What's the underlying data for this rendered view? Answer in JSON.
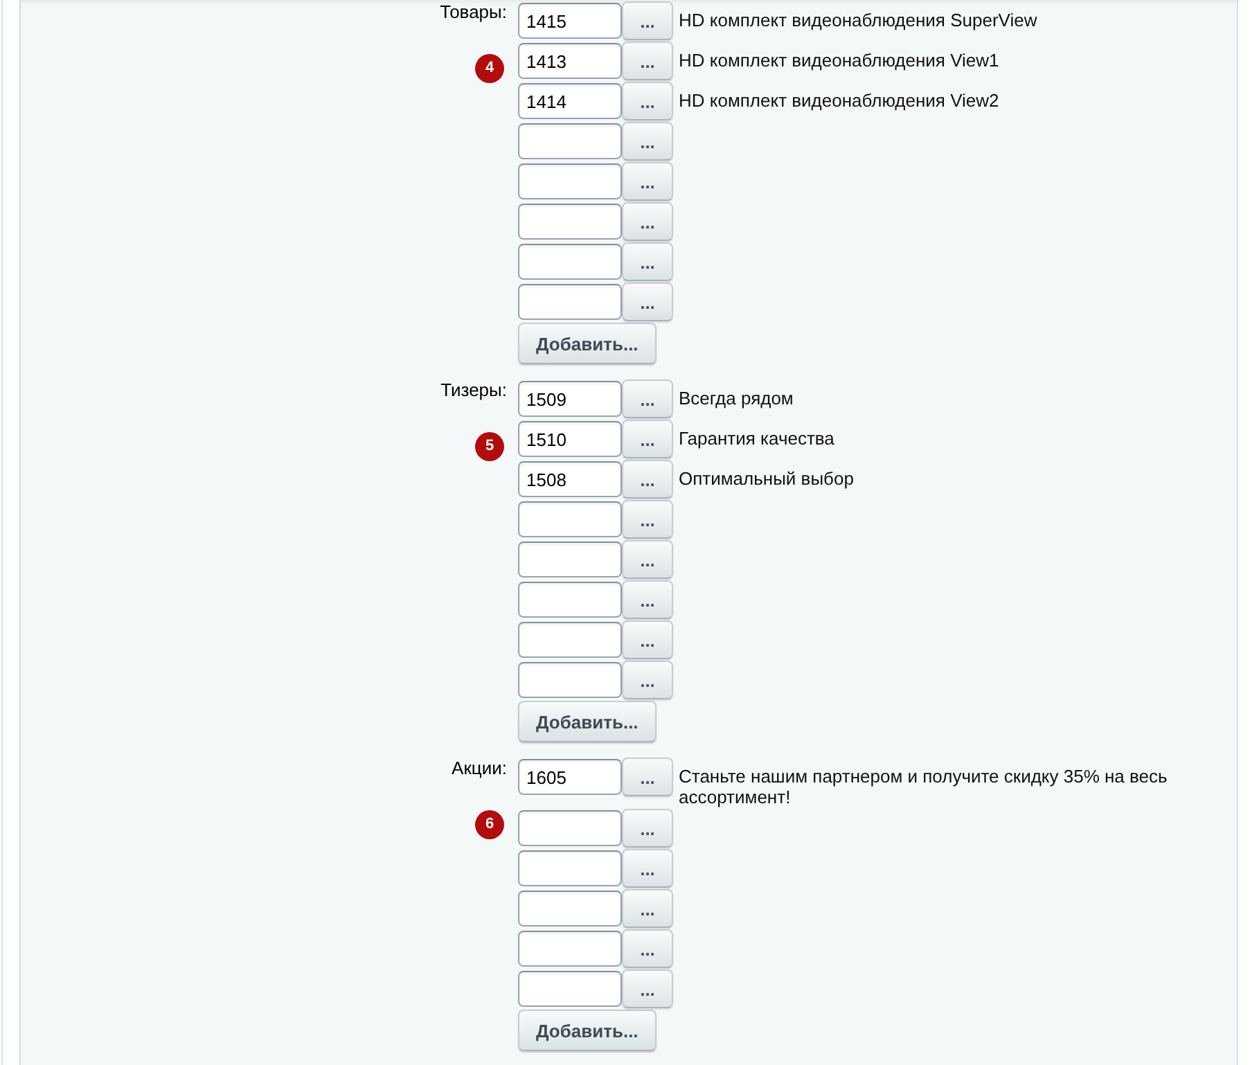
{
  "sections": [
    {
      "label": "Товары:",
      "marker": "4",
      "rows": [
        {
          "value": "1415",
          "button": "...",
          "description": "HD комплект видеонаблюдения SuperView"
        },
        {
          "value": "1413",
          "button": "...",
          "description": "HD комплект видеонаблюдения View1"
        },
        {
          "value": "1414",
          "button": "...",
          "description": "HD комплект видеонаблюдения View2"
        },
        {
          "button": "..."
        },
        {
          "button": "..."
        },
        {
          "button": "..."
        },
        {
          "button": "..."
        },
        {
          "button": "..."
        }
      ],
      "add_button": "Добавить..."
    },
    {
      "label": "Тизеры:",
      "marker": "5",
      "rows": [
        {
          "value": "1509",
          "button": "...",
          "description": "Всегда рядом"
        },
        {
          "value": "1510",
          "button": "...",
          "description": "Гарантия качества"
        },
        {
          "value": "1508",
          "button": "...",
          "description": "Оптимальный выбор"
        },
        {
          "button": "..."
        },
        {
          "button": "..."
        },
        {
          "button": "..."
        },
        {
          "button": "..."
        },
        {
          "button": "..."
        }
      ],
      "add_button": "Добавить..."
    },
    {
      "label": "Акции:",
      "marker": "6",
      "rows": [
        {
          "value": "1605",
          "button": "...",
          "description": "Станьте нашим партнером и получите скидку 35% на весь ассортимент!"
        },
        {
          "button": "..."
        },
        {
          "button": "..."
        },
        {
          "button": "..."
        },
        {
          "button": "..."
        },
        {
          "button": "..."
        }
      ],
      "add_button": "Добавить..."
    }
  ]
}
